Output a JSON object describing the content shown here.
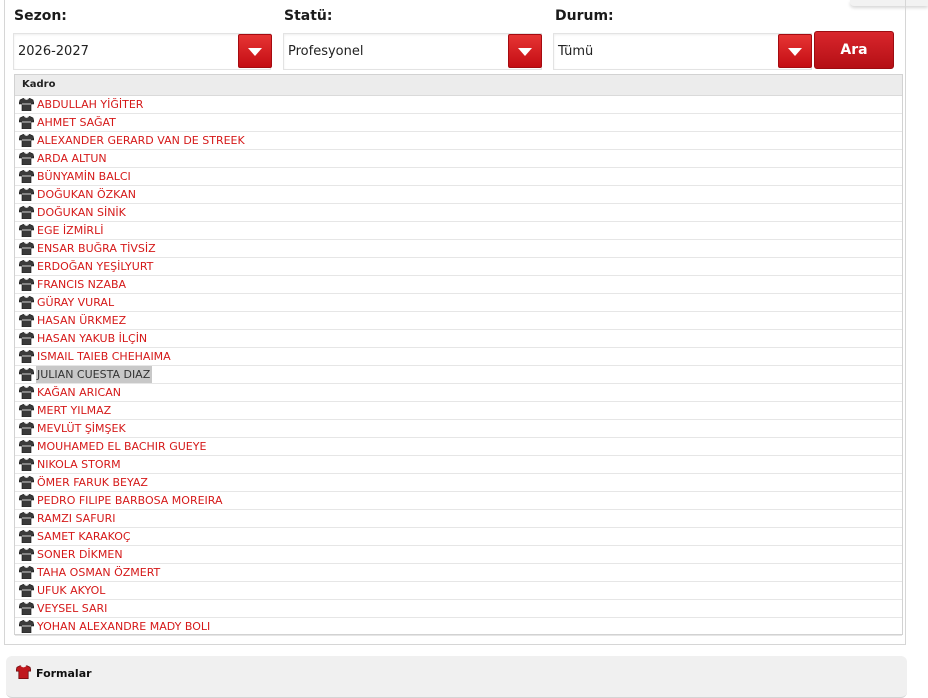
{
  "filters": {
    "season": {
      "label": "Sezon:",
      "value": "2026-2027"
    },
    "status": {
      "label": "Statü:",
      "value": "Profesyonel"
    },
    "condition": {
      "label": "Durum:",
      "value": "Tümü"
    },
    "search_button": "Ara"
  },
  "roster": {
    "header": "Kadro",
    "players": [
      "ABDULLAH YİĞİTER",
      "AHMET SAĞAT",
      "ALEXANDER GERARD VAN DE STREEK",
      "ARDA ALTUN",
      "BÜNYAMİN BALCI",
      "DOĞUKAN ÖZKAN",
      "DOĞUKAN SİNİK",
      "EGE İZMİRLİ",
      "ENSAR BUĞRA TİVSİZ",
      "ERDOĞAN YEŞİLYURT",
      "FRANCIS NZABA",
      "GÜRAY VURAL",
      "HASAN ÜRKMEZ",
      "HASAN YAKUB İLÇİN",
      "ISMAIL TAIEB CHEHAIMA",
      "JULIAN CUESTA DIAZ",
      "KAĞAN ARICAN",
      "MERT YILMAZ",
      "MEVLÜT ŞİMŞEK",
      "MOUHAMED EL BACHIR GUEYE",
      "NIKOLA STORM",
      "ÖMER FARUK BEYAZ",
      "PEDRO FILIPE BARBOSA MOREIRA",
      "RAMZI SAFURI",
      "SAMET KARAKOÇ",
      "SONER DİKMEN",
      "TAHA OSMAN ÖZMERT",
      "UFUK AKYOL",
      "VEYSEL SARI",
      "YOHAN ALEXANDRE MADY BOLI"
    ],
    "highlighted_index": 15,
    "row_icon": "jersey-icon"
  },
  "formalar": {
    "label": "Formalar",
    "icon": "jersey-icon"
  },
  "colors": {
    "accent": "#d51919",
    "button": "#c40d13"
  }
}
